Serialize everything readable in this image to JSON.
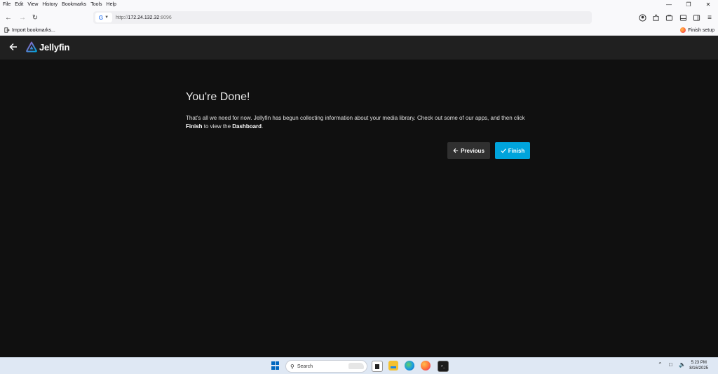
{
  "browser": {
    "menu": [
      "File",
      "Edit",
      "View",
      "History",
      "Bookmarks",
      "Tools",
      "Help"
    ],
    "url_scheme": "http://",
    "url_host": "172.24.132.32",
    "url_port": ":8096",
    "search_engine_badge": "G",
    "bookmarks": {
      "import_label": "Import bookmarks...",
      "finish_setup_label": "Finish setup"
    }
  },
  "app": {
    "name": "Jellyfin",
    "brand_color": "#00a4dc",
    "logo_gradient": [
      "#aa5cc3",
      "#00a4dc"
    ]
  },
  "wizard": {
    "title": "You're Done!",
    "text_1": "That's all we need for now. Jellyfin has begun collecting information about your media library. Check out some of our apps, and then click ",
    "text_finish": "Finish",
    "text_2": " to view the ",
    "text_dashboard": "Dashboard",
    "text_3": ".",
    "previous_label": "Previous",
    "finish_label": "Finish"
  },
  "taskbar": {
    "search_label": "Search",
    "time": "5:23 PM",
    "date": "8/16/2025"
  }
}
